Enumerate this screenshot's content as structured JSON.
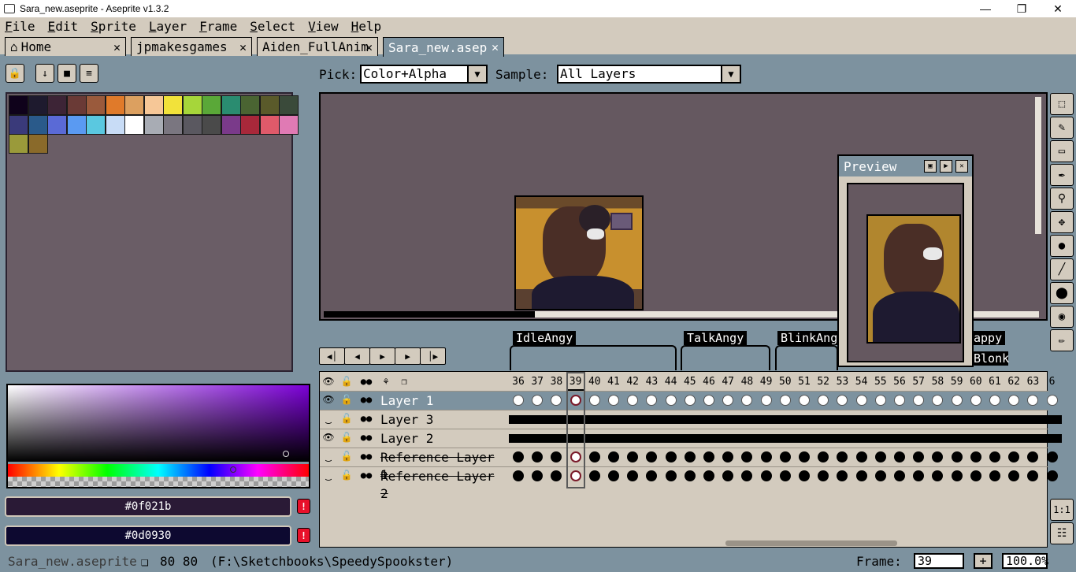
{
  "window": {
    "title": "Sara_new.aseprite - Aseprite v1.3.2",
    "minimize": "—",
    "maximize": "❐",
    "close": "✕"
  },
  "menu": [
    "File",
    "Edit",
    "Sprite",
    "Layer",
    "Frame",
    "Select",
    "View",
    "Help"
  ],
  "tabs": [
    {
      "label": "Home",
      "icon": "home-icon"
    },
    {
      "label": "jpmakesgames"
    },
    {
      "label": "Aiden_FullAnim"
    },
    {
      "label": "Sara_new.asep",
      "active": true
    }
  ],
  "tab_close": "✕",
  "context_bar": {
    "pick_label": "Pick:",
    "pick_value": "Color+Alpha",
    "sample_label": "Sample:",
    "sample_value": "All Layers"
  },
  "palette": {
    "colors": [
      "#0f021b",
      "#1e1a2e",
      "#3d2436",
      "#6a3a36",
      "#9a5a3c",
      "#e07a2a",
      "#dca060",
      "#f6c797",
      "#f2e23a",
      "#a6d63a",
      "#5aa838",
      "#2a8c70",
      "#4a6432",
      "#5a5a2a",
      "#3a4a3a",
      "#3a3a7a",
      "#2a5a8a",
      "#5a6ad6",
      "#5a9af2",
      "#5ac8e0",
      "#c8dcf6",
      "#ffffff",
      "#a8acb4",
      "#7a7680",
      "#5a5860",
      "#4a4a4a",
      "#7a3a8a",
      "#a8283a",
      "#e05a6a",
      "#e07ab4",
      "#9a9a3a",
      "#8a6a2a"
    ]
  },
  "colors": {
    "foreground": "#0f021b",
    "background": "#0d0930",
    "warn": "!"
  },
  "preview": {
    "title": "Preview"
  },
  "tags": [
    "IdleAngy",
    "TalkAngy",
    "BlinkAngy",
    "appy",
    "Blonk"
  ],
  "frames": [
    "36",
    "37",
    "38",
    "39",
    "40",
    "41",
    "42",
    "43",
    "44",
    "45",
    "46",
    "47",
    "48",
    "49",
    "50",
    "51",
    "52",
    "53",
    "54",
    "55",
    "56",
    "57",
    "58",
    "59",
    "60",
    "61",
    "62",
    "63",
    "6"
  ],
  "current_frame": "39",
  "layers": [
    {
      "name": "Layer 1",
      "visible": true,
      "selected": true,
      "cels": "empty"
    },
    {
      "name": "Layer 3",
      "visible": false,
      "cels": "line"
    },
    {
      "name": "Layer 2",
      "visible": true,
      "cels": "line"
    },
    {
      "name": "Reference Layer 1",
      "visible": false,
      "cels": "filled",
      "reference": true
    },
    {
      "name": "Reference Layer 2",
      "visible": false,
      "cels": "filled",
      "reference": true
    }
  ],
  "status": {
    "filename": "Sara_new.aseprite",
    "size": "80 80",
    "path": "(F:\\Sketchbooks\\SpeedySpookster)",
    "frame_label": "Frame:",
    "frame_value": "39",
    "add": "+",
    "zoom": "100.0%"
  },
  "toolbar_right_bottom": {
    "zoom_ratio": "1:1"
  }
}
